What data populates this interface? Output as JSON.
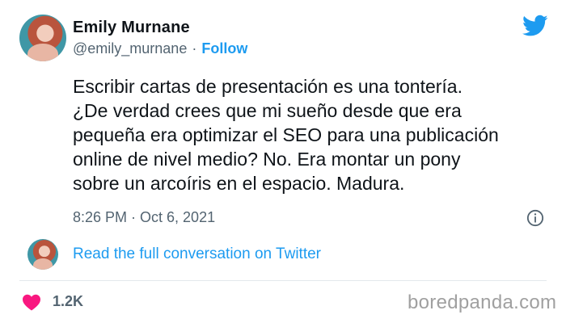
{
  "header": {
    "name": "Emily Murnane",
    "handle": "@emily_murnane",
    "separator": "·",
    "follow_label": "Follow",
    "brand_icon": "twitter-bird-icon"
  },
  "tweet": {
    "lines": [
      "Escribir cartas de presentación es una tontería.",
      "¿De verdad crees que mi sueño desde que era",
      "pequeña era optimizar el SEO para una publicación",
      "online de nivel medio? No. Era montar un pony",
      "sobre un arcoíris en el espacio. Madura."
    ],
    "timestamp": "8:26 PM · Oct 6, 2021",
    "info_icon": "info-icon"
  },
  "conversation": {
    "link_text": "Read the full conversation on Twitter"
  },
  "footer": {
    "heart_icon": "heart-icon",
    "likes": "1.2K",
    "watermark": "boredpanda.com"
  },
  "colors": {
    "accent": "#1d9bf0",
    "heart": "#f91880",
    "muted_text": "#536471",
    "text": "#0f1419"
  }
}
